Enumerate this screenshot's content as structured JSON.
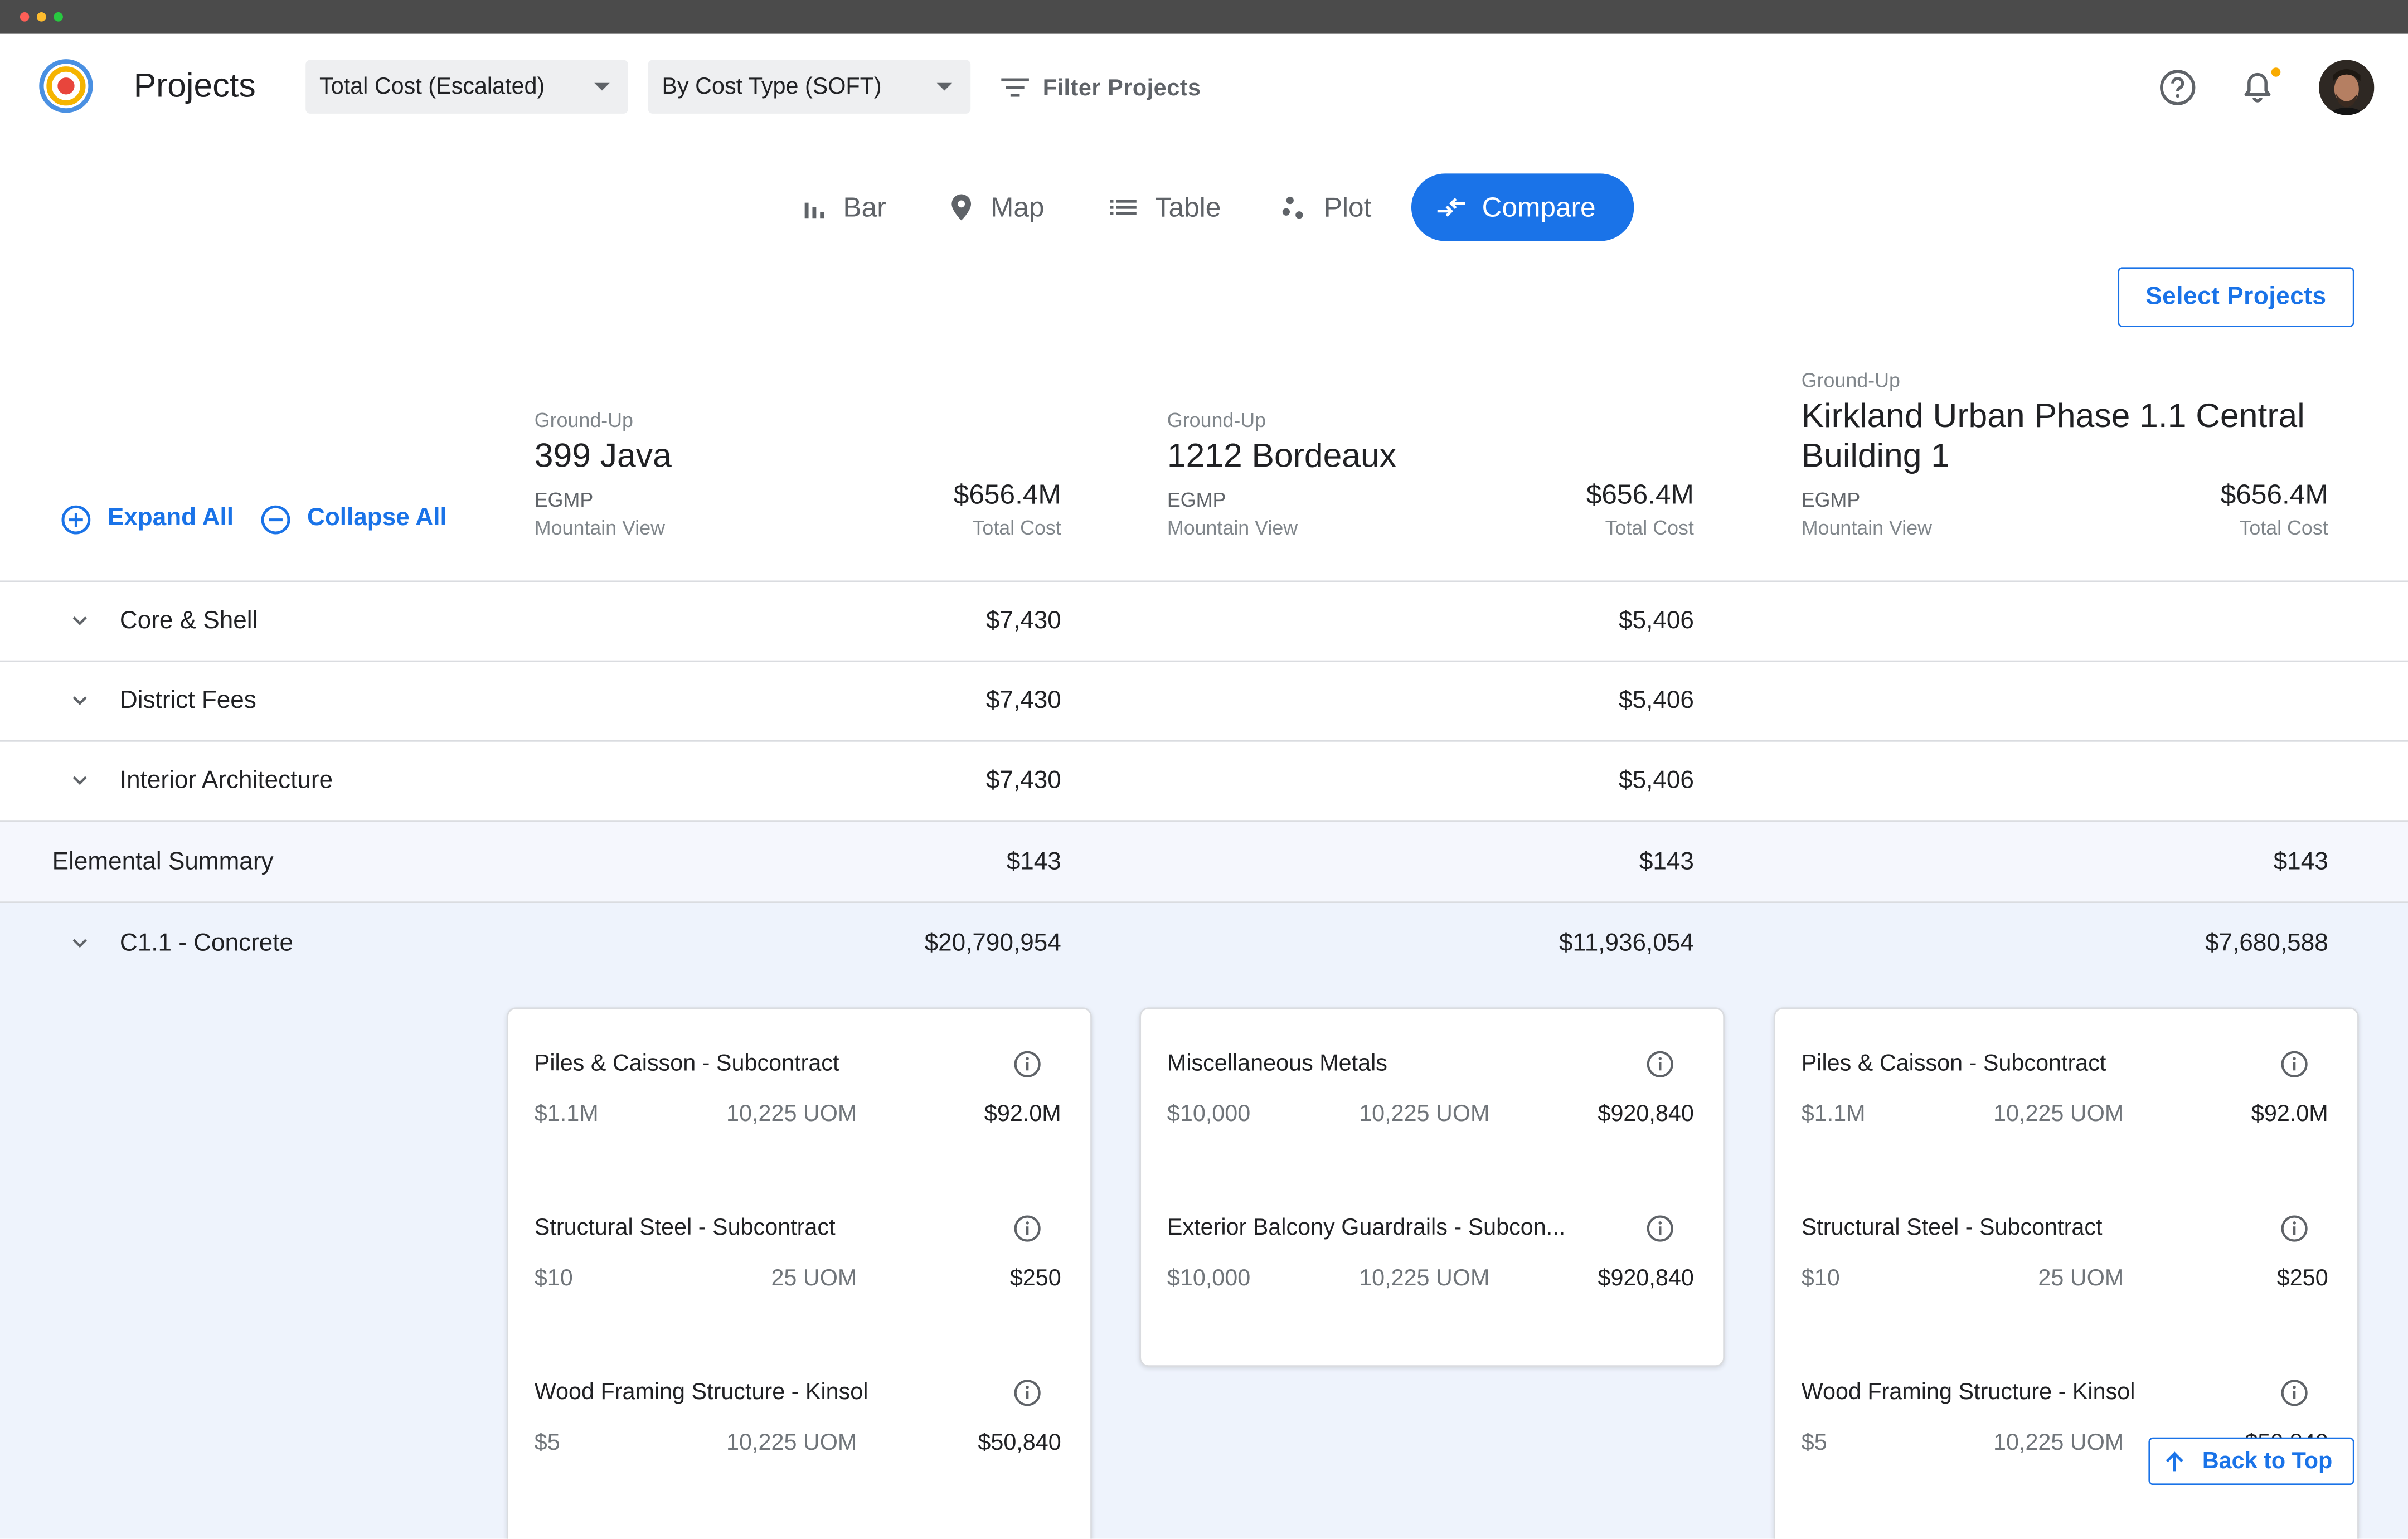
{
  "app": {
    "title": "Projects"
  },
  "toolbar": {
    "cost_select": "Total Cost (Escalated)",
    "type_select": "By Cost Type (SOFT)",
    "filter_label": "Filter Projects"
  },
  "tabs": [
    {
      "label": "Bar",
      "icon": "bar-chart-icon"
    },
    {
      "label": "Map",
      "icon": "map-pin-icon"
    },
    {
      "label": "Table",
      "icon": "list-icon"
    },
    {
      "label": "Plot",
      "icon": "scatter-icon"
    },
    {
      "label": "Compare",
      "icon": "compare-arrows-icon",
      "active": true
    }
  ],
  "select_projects_label": "Select Projects",
  "expand_all_label": "Expand All",
  "collapse_all_label": "Collapse All",
  "projects": [
    {
      "type": "Ground-Up",
      "name": "399 Java",
      "org": "EGMP",
      "location": "Mountain View",
      "total": "$656.4M",
      "total_label": "Total Cost"
    },
    {
      "type": "Ground-Up",
      "name": "1212 Bordeaux",
      "org": "EGMP",
      "location": "Mountain View",
      "total": "$656.4M",
      "total_label": "Total Cost"
    },
    {
      "type": "Ground-Up",
      "name_line1": "Kirkland Urban Phase 1.1 Central",
      "name_line2": "Building 1",
      "org": "EGMP",
      "location": "Mountain View",
      "total": "$656.4M",
      "total_label": "Total Cost"
    }
  ],
  "rows": [
    {
      "label": "Core & Shell",
      "values": [
        "$7,430",
        "$5,406",
        ""
      ]
    },
    {
      "label": "District Fees",
      "values": [
        "$7,430",
        "$5,406",
        ""
      ]
    },
    {
      "label": "Interior Architecture",
      "values": [
        "$7,430",
        "$5,406",
        ""
      ]
    }
  ],
  "summary": {
    "label": "Elemental Summary",
    "values": [
      "$143",
      "$143",
      "$143"
    ]
  },
  "concrete": {
    "label": "C1.1 - Concrete",
    "values": [
      "$20,790,954",
      "$11,936,054",
      "$7,680,588"
    ]
  },
  "cards": [
    [
      {
        "title": "Piles & Caisson - Subcontract",
        "unit": "$1.1M",
        "qty": "10,225 UOM",
        "total": "$92.0M"
      },
      {
        "title": "Structural Steel - Subcontract",
        "unit": "$10",
        "qty": "25 UOM",
        "total": "$250"
      },
      {
        "title": "Wood Framing Structure - Kinsol",
        "unit": "$5",
        "qty": "10,225 UOM",
        "total": "$50,840"
      }
    ],
    [
      {
        "title": "Miscellaneous Metals",
        "unit": "$10,000",
        "qty": "10,225 UOM",
        "total": "$920,840"
      },
      {
        "title": "Exterior Balcony Guardrails - Subcon...",
        "unit": "$10,000",
        "qty": "10,225 UOM",
        "total": "$920,840"
      }
    ],
    [
      {
        "title": "Piles & Caisson - Subcontract",
        "unit": "$1.1M",
        "qty": "10,225 UOM",
        "total": "$92.0M"
      },
      {
        "title": "Structural Steel - Subcontract",
        "unit": "$10",
        "qty": "25 UOM",
        "total": "$250"
      },
      {
        "title": "Wood Framing Structure - Kinsol",
        "unit": "$5",
        "qty": "10,225 UOM",
        "total": "$50,840"
      }
    ]
  ],
  "back_to_top_label": "Back to Top",
  "colors": {
    "accent": "#1a73e8",
    "summary_bg": "#f5f7fd",
    "concrete_bg": "#eef3fc",
    "notification_dot": "#f9ab00"
  }
}
